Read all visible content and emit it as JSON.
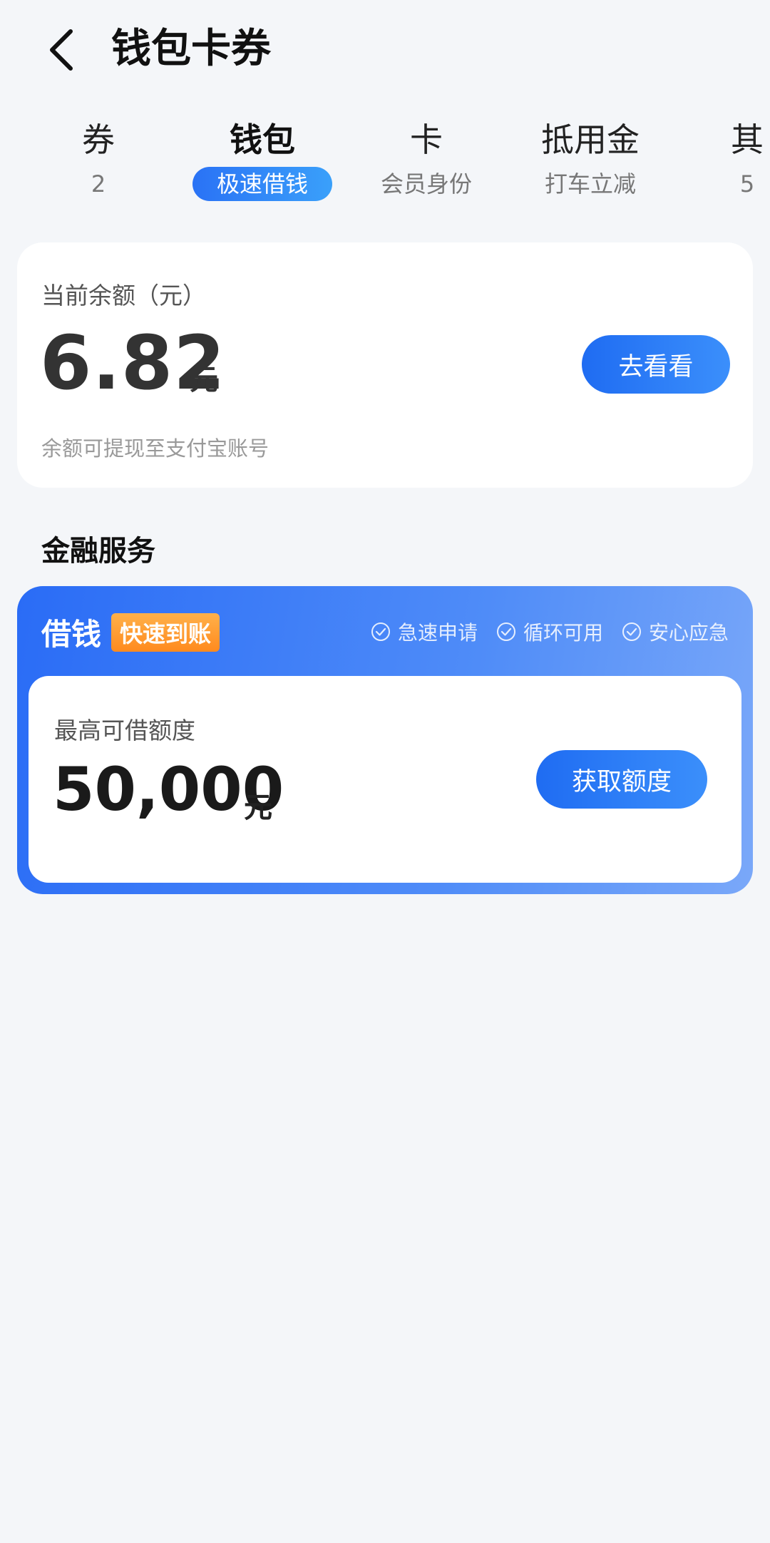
{
  "header": {
    "title": "钱包卡券"
  },
  "tabs": [
    {
      "label": "券",
      "sub": "2"
    },
    {
      "label": "钱包",
      "sub": "极速借钱",
      "active": true
    },
    {
      "label": "卡",
      "sub": "会员身份"
    },
    {
      "label": "抵用金",
      "sub": "打车立减"
    },
    {
      "label": "其",
      "sub": "5"
    }
  ],
  "balance": {
    "label": "当前余额（元）",
    "amount": "6.82",
    "unit": "元",
    "note": "余额可提现至支付宝账号",
    "button": "去看看"
  },
  "finance": {
    "section_title": "金融服务",
    "loan_title": "借钱",
    "badge": "快速到账",
    "features": [
      "急速申请",
      "循环可用",
      "安心应急"
    ],
    "limit_label": "最高可借额度",
    "limit_amount": "50,000",
    "limit_unit": "元",
    "button": "获取额度"
  },
  "colors": {
    "accent": "#2a72f5",
    "badge": "#ff9a2e",
    "background": "#f4f6f9"
  }
}
